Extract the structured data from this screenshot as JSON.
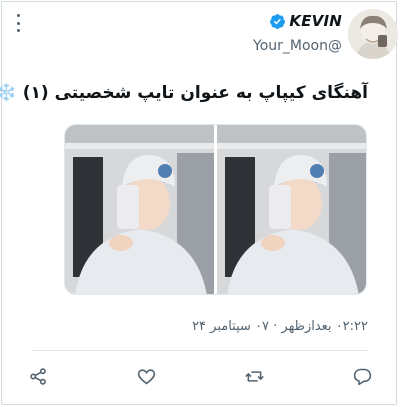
{
  "tweet": {
    "display_name": "KEVIN",
    "handle": "Your_Moon@",
    "text": "آهنگای کیپاپ به عنوان تایپ شخصیتی (۱)",
    "emoji": "❄️",
    "timestamp": "۰۲:۲۲ بعدازظهر · ۰۷ سپتامبر ۲۴"
  },
  "media": {
    "count": 2
  },
  "actions": {
    "share": "share-icon",
    "like": "heart-icon",
    "retweet": "retweet-icon",
    "reply": "reply-icon"
  },
  "colors": {
    "verified": "#1d9bf0",
    "secondary_text": "#536471",
    "border": "#cfd9de"
  }
}
